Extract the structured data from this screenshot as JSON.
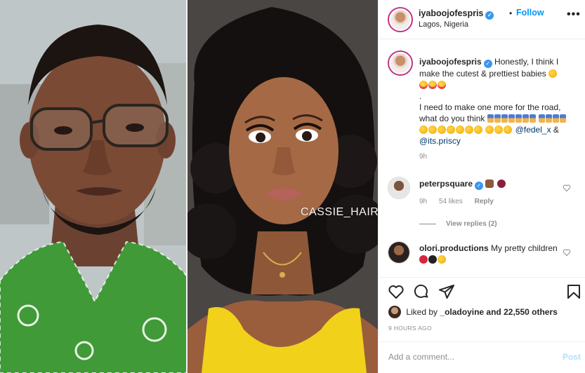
{
  "photo": {
    "watermark": "CASSIE_HAIR"
  },
  "header": {
    "username": "iyaboojofespris",
    "dot": "•",
    "follow": "Follow",
    "location": "Lagos, Nigeria",
    "more": "•••"
  },
  "caption": {
    "username": "iyaboojofespris",
    "text_1": "Honestly, I think I make the cutest & prettiest babies",
    "text_2": ".",
    "text_3": "I need to make one more for the road, what do you think",
    "mention_1": "@fedel_x",
    "amp": "&",
    "mention_2": "@its.priscy",
    "time": "9h"
  },
  "comments": [
    {
      "username": "peterpsquare",
      "text": "",
      "time": "9h",
      "likes": "54 likes",
      "reply": "Reply",
      "view_replies": "View replies (2)"
    },
    {
      "username": "olori.productions",
      "text": "My pretty children"
    }
  ],
  "likes": {
    "prefix": "Liked by",
    "user": "_oladoyine",
    "suffix": "and 22,550 others"
  },
  "posted_ago": "9 HOURS AGO",
  "add_comment": {
    "placeholder": "Add a comment...",
    "post": "Post"
  },
  "colors": {
    "accent": "#0095f6",
    "verified": "#3897f0",
    "muted": "#8e8e8e",
    "post_disabled": "#b2dffc"
  },
  "icons": [
    "heart-icon",
    "comment-icon",
    "share-icon",
    "bookmark-icon",
    "more-icon",
    "verified-icon"
  ]
}
